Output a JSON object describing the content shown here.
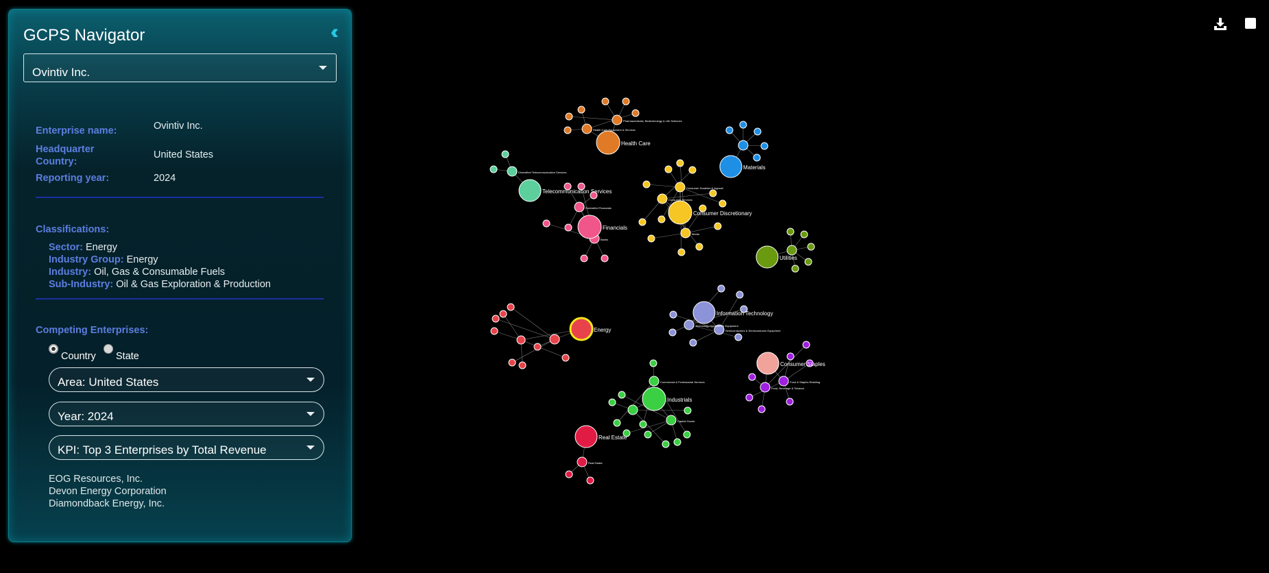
{
  "panel": {
    "title": "GCPS Navigator",
    "selected_enterprise": "Ovintiv Inc.",
    "labels": {
      "enterprise_name": "Enterprise name:",
      "hq_country_line1": "Headquarter",
      "hq_country_line2": "Country:",
      "reporting_year": "Reporting year:",
      "classifications": "Classifications:",
      "competing": "Competing Enterprises:"
    },
    "values": {
      "enterprise_name": "Ovintiv Inc.",
      "hq_country": "United States",
      "reporting_year": "2024"
    },
    "classifications": {
      "sector_label": "Sector:",
      "sector": "Energy",
      "industry_group_label": "Industry Group:",
      "industry_group": "Energy",
      "industry_label": "Industry:",
      "industry": "Oil, Gas & Consumable Fuels",
      "sub_industry_label": "Sub-Industry:",
      "sub_industry": "Oil & Gas Exploration & Production"
    },
    "scope": {
      "country_label": "Country",
      "state_label": "State",
      "selected": "Country"
    },
    "area": "Area: United States",
    "year": "Year: 2024",
    "kpi": "KPI: Top 3 Enterprises by Total Revenue",
    "competitors": [
      "EOG Resources, Inc.",
      "Devon Energy Corporation",
      "Diamondback Energy, Inc."
    ]
  },
  "toolbar": {
    "download_icon": "download-icon",
    "fullscreen_icon": "square-icon"
  },
  "colors": {
    "health_care": "#e07a27",
    "materials": "#1f8fe6",
    "telecom": "#5ccf9c",
    "financials": "#f0568a",
    "consumer_disc": "#f5c624",
    "utilities": "#6a9a10",
    "energy": "#e8434a",
    "energy_ring": "#f3e81a",
    "it": "#8c93d8",
    "consumer_staples": "#a020e0",
    "consumer_staples_hub": "#f1a29b",
    "industrials": "#3bcf44",
    "real_estate": "#e01c45"
  },
  "chart_data": {
    "type": "network",
    "sectors": [
      {
        "name": "Health Care",
        "subnodes": [
          "Health Care Equipment & Services",
          "Pharmaceuticals, Biotechnology & Life Sciences"
        ]
      },
      {
        "name": "Materials",
        "subnodes": []
      },
      {
        "name": "Telecommunication Services",
        "subnodes": [
          "Diversified Telecommunication Services"
        ]
      },
      {
        "name": "Financials",
        "subnodes": [
          "Diversified Financials",
          "Banks"
        ]
      },
      {
        "name": "Consumer Discretionary",
        "subnodes": [
          "Consumer Durables & Apparel",
          "Media",
          "Consumer Services"
        ]
      },
      {
        "name": "Utilities",
        "subnodes": []
      },
      {
        "name": "Energy",
        "subnodes": []
      },
      {
        "name": "Information Technology",
        "subnodes": [
          "Technology Hardware & Equipment",
          "Semiconductors & Semiconductor Equipment"
        ]
      },
      {
        "name": "Consumer Staples",
        "subnodes": [
          "Food & Staples Retailing",
          "Food, Beverage & Tobacco"
        ]
      },
      {
        "name": "Industrials",
        "subnodes": [
          "Commercial & Professional Services",
          "Capital Goods"
        ]
      },
      {
        "name": "Real Estate",
        "subnodes": [
          "Real Estate"
        ]
      }
    ],
    "highlighted": "Energy"
  }
}
